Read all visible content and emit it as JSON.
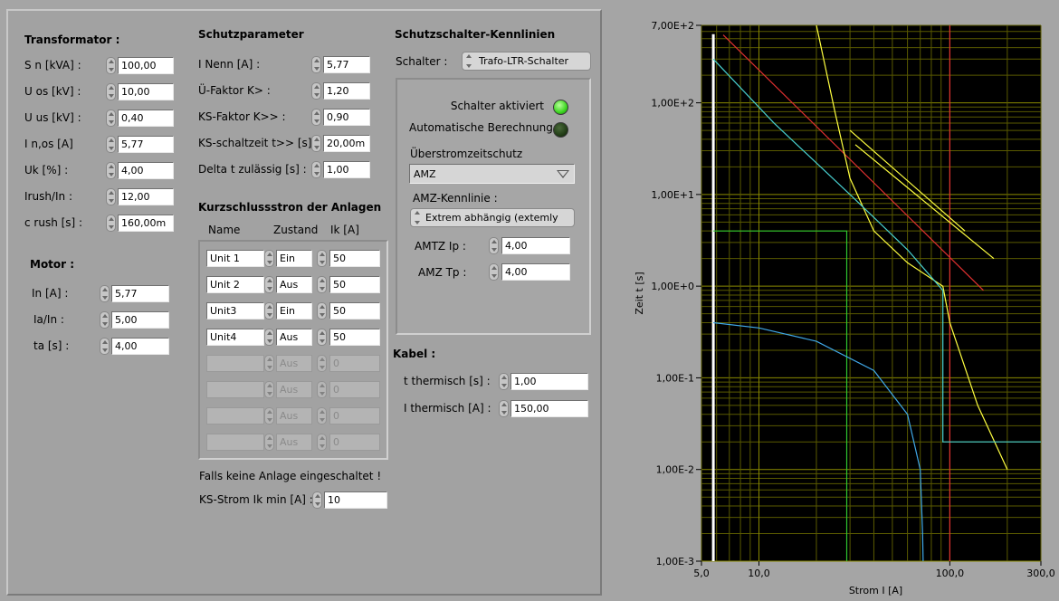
{
  "transformator": {
    "title": "Transformator :",
    "rows": [
      {
        "label": "S n [kVA] :",
        "value": "100,00"
      },
      {
        "label": "U os [kV] :",
        "value": "10,00"
      },
      {
        "label": "U us [kV] :",
        "value": "0,40"
      },
      {
        "label": "I n,os [A]",
        "value": "5,77"
      },
      {
        "label": "Uk [%] :",
        "value": "4,00"
      },
      {
        "label": "Irush/In :",
        "value": "12,00"
      },
      {
        "label": "c rush [s] :",
        "value": "160,00m"
      }
    ]
  },
  "motor": {
    "title": "Motor :",
    "rows": [
      {
        "label": "In [A] :",
        "value": "5,77"
      },
      {
        "label": "Ia/In :",
        "value": "5,00"
      },
      {
        "label": "ta [s] :",
        "value": "4,00"
      }
    ]
  },
  "schutzparameter": {
    "title": "Schutzparameter",
    "rows": [
      {
        "label": "I Nenn [A] :",
        "value": "5,77"
      },
      {
        "label": "Ü-Faktor K> :",
        "value": "1,20"
      },
      {
        "label": "KS-Faktor K>> :",
        "value": "0,90"
      },
      {
        "label": "KS-schaltzeit t>> [s] :",
        "value": "20,00m"
      },
      {
        "label": "Delta t zulässig [s] :",
        "value": "1,00"
      }
    ]
  },
  "kurzschluss": {
    "title": "Kurzschlussstron der Anlagen",
    "col_name": "Name",
    "col_zustand": "Zustand",
    "col_ik": "Ik [A]",
    "rows": [
      {
        "name": "Unit 1",
        "zustand": "Ein",
        "ik": "50"
      },
      {
        "name": "Unit 2",
        "zustand": "Aus",
        "ik": "50"
      },
      {
        "name": "Unit3",
        "zustand": "Ein",
        "ik": "50"
      },
      {
        "name": "Unit4",
        "zustand": "Aus",
        "ik": "50"
      },
      {
        "name": "",
        "zustand": "Aus",
        "ik": "0"
      },
      {
        "name": "",
        "zustand": "Aus",
        "ik": "0"
      },
      {
        "name": "",
        "zustand": "Aus",
        "ik": "0"
      },
      {
        "name": "",
        "zustand": "Aus",
        "ik": "0"
      }
    ],
    "note": "Falls keine Anlage eingeschaltet !",
    "min_label": "KS-Strom Ik min [A] :",
    "min_value": "10"
  },
  "kennlinien": {
    "title": "Schutzschalter-Kennlinien",
    "schalter_label": "Schalter :",
    "schalter_value": "Trafo-LTR-Schalter",
    "schalter_aktiviert": "Schalter aktiviert",
    "auto_berechnung": "Automatische Berechnung",
    "ueberstrom_label": "Überstromzeitschutz",
    "ueberstrom_value": "AMZ",
    "amz_kennlinie_label": "AMZ-Kennlinie :",
    "amz_kennlinie_value": "Extrem abhängig (extemly",
    "amtz_ip_label": "AMTZ Ip :",
    "amtz_ip_value": "4,00",
    "amz_tp_label": "AMZ Tp :",
    "amz_tp_value": "4,00",
    "led_on_color": "#3bd51f",
    "led_off_color": "#1f3a14"
  },
  "kabel": {
    "title": "Kabel :",
    "t_label": "t thermisch [s] :",
    "t_value": "1,00",
    "i_label": "I thermisch [A] :",
    "i_value": "150,00"
  },
  "chart_data": {
    "type": "line",
    "xscale": "log",
    "yscale": "log",
    "xlim": [
      5.0,
      300.0
    ],
    "ylim": [
      0.001,
      700
    ],
    "xlabel": "Strom I [A]",
    "ylabel": "Zeit t [s]",
    "x_tick_labels": [
      "5,0",
      "10,0",
      "100,0",
      "300,0"
    ],
    "y_tick_labels": [
      "7,00E+2",
      "1,00E+2",
      "1,00E+1",
      "1,00E+0",
      "1,00E-1",
      "1,00E-2",
      "1,00E-3"
    ],
    "grid": true,
    "series": [
      {
        "color": "#ffffff",
        "points": [
          [
            5.77,
            0.001
          ],
          [
            5.77,
            560
          ]
        ]
      },
      {
        "color": "#2ec62e",
        "points": [
          [
            5.77,
            4.0
          ],
          [
            28.85,
            4.0
          ],
          [
            28.85,
            0.001
          ]
        ]
      },
      {
        "color": "#e03030",
        "points": [
          [
            6.5,
            550
          ],
          [
            150,
            0.9
          ]
        ]
      },
      {
        "color": "#e03030",
        "points": [
          [
            100,
            0.001
          ],
          [
            100,
            700
          ]
        ]
      },
      {
        "color": "#ffff40",
        "points": [
          [
            20,
            700
          ],
          [
            25,
            80
          ],
          [
            30,
            15
          ],
          [
            40,
            4
          ],
          [
            60,
            1.8
          ],
          [
            92,
            1.0
          ],
          [
            100,
            0.4
          ],
          [
            140,
            0.05
          ],
          [
            200,
            0.01
          ]
        ]
      },
      {
        "color": "#ffff40",
        "points": [
          [
            30,
            50
          ],
          [
            120,
            4
          ]
        ]
      },
      {
        "color": "#ffff40",
        "points": [
          [
            32,
            35
          ],
          [
            170,
            2
          ]
        ]
      },
      {
        "color": "#48d0d0",
        "points": [
          [
            5.77,
            300
          ],
          [
            12,
            60
          ],
          [
            30,
            10
          ],
          [
            60,
            2.5
          ],
          [
            92,
            0.9
          ],
          [
            92,
            0.02
          ],
          [
            300,
            0.02
          ]
        ]
      },
      {
        "color": "#40a8e8",
        "points": [
          [
            5.77,
            0.4
          ],
          [
            10,
            0.35
          ],
          [
            20,
            0.25
          ],
          [
            40,
            0.12
          ],
          [
            60,
            0.04
          ],
          [
            70,
            0.01
          ],
          [
            72,
            0.002
          ],
          [
            72.5,
            0.001
          ]
        ]
      }
    ]
  }
}
